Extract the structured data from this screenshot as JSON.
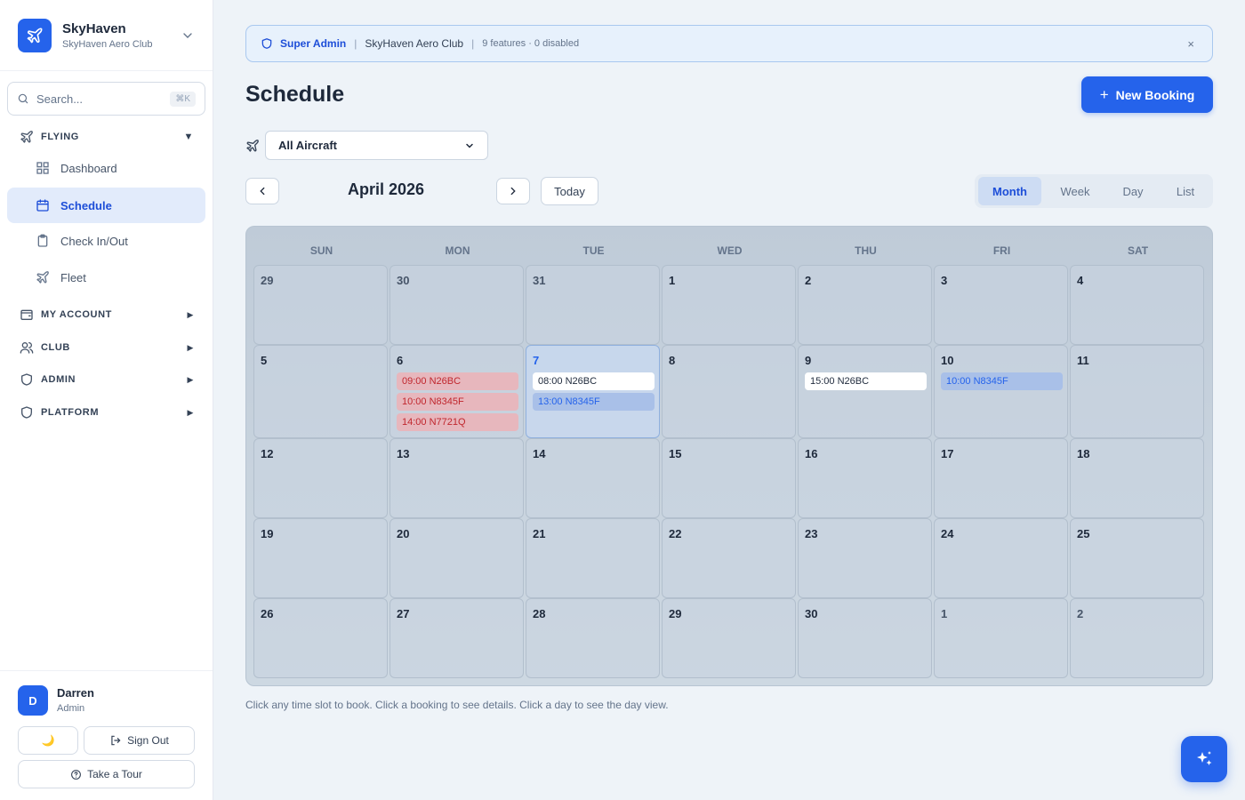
{
  "brand": {
    "name": "SkyHaven",
    "subtitle": "SkyHaven Aero Club"
  },
  "search": {
    "placeholder": "Search...",
    "shortcut": "⌘K"
  },
  "sidebar": {
    "sections": [
      {
        "label": "FLYING",
        "expanded": true
      },
      {
        "label": "MY ACCOUNT",
        "expanded": false
      },
      {
        "label": "CLUB",
        "expanded": false
      },
      {
        "label": "ADMIN",
        "expanded": false
      },
      {
        "label": "PLATFORM",
        "expanded": false
      }
    ],
    "items": [
      {
        "label": "Dashboard",
        "active": false
      },
      {
        "label": "Schedule",
        "active": true
      },
      {
        "label": "Check In/Out",
        "active": false
      },
      {
        "label": "Fleet",
        "active": false
      }
    ]
  },
  "user": {
    "initial": "D",
    "name": "Darren",
    "role": "Admin"
  },
  "footer": {
    "theme_icon": "🌙",
    "sign_out": "Sign Out",
    "tour": "Take a Tour"
  },
  "banner": {
    "role": "Super Admin",
    "club": "SkyHaven Aero Club",
    "features": "9 features · 0 disabled",
    "close": "×"
  },
  "page": {
    "title": "Schedule",
    "new_booking": "New Booking"
  },
  "filter": {
    "aircraft": "All Aircraft"
  },
  "calendar": {
    "month_label": "April 2026",
    "today_label": "Today",
    "views": [
      "Month",
      "Week",
      "Day",
      "List"
    ],
    "active_view": "Month",
    "weekdays": [
      "SUN",
      "MON",
      "TUE",
      "WED",
      "THU",
      "FRI",
      "SAT"
    ],
    "weeks": [
      [
        {
          "day": "29",
          "muted": true
        },
        {
          "day": "30",
          "muted": true
        },
        {
          "day": "31",
          "muted": true
        },
        {
          "day": "1"
        },
        {
          "day": "2"
        },
        {
          "day": "3"
        },
        {
          "day": "4"
        }
      ],
      [
        {
          "day": "5"
        },
        {
          "day": "6",
          "events": [
            {
              "text": "09:00 N26BC",
              "style": "red"
            },
            {
              "text": "10:00 N8345F",
              "style": "red"
            },
            {
              "text": "14:00 N7721Q",
              "style": "red"
            }
          ]
        },
        {
          "day": "7",
          "today": true,
          "events": [
            {
              "text": "08:00 N26BC",
              "style": "white"
            },
            {
              "text": "13:00 N8345F",
              "style": "blue"
            }
          ]
        },
        {
          "day": "8"
        },
        {
          "day": "9",
          "events": [
            {
              "text": "15:00 N26BC",
              "style": "white"
            }
          ]
        },
        {
          "day": "10",
          "events": [
            {
              "text": "10:00 N8345F",
              "style": "blue"
            }
          ]
        },
        {
          "day": "11"
        }
      ],
      [
        {
          "day": "12"
        },
        {
          "day": "13"
        },
        {
          "day": "14"
        },
        {
          "day": "15"
        },
        {
          "day": "16"
        },
        {
          "day": "17"
        },
        {
          "day": "18"
        }
      ],
      [
        {
          "day": "19"
        },
        {
          "day": "20"
        },
        {
          "day": "21"
        },
        {
          "day": "22"
        },
        {
          "day": "23"
        },
        {
          "day": "24"
        },
        {
          "day": "25"
        }
      ],
      [
        {
          "day": "26"
        },
        {
          "day": "27"
        },
        {
          "day": "28"
        },
        {
          "day": "29"
        },
        {
          "day": "30"
        },
        {
          "day": "1",
          "muted": true
        },
        {
          "day": "2",
          "muted": true
        }
      ]
    ]
  },
  "hint": "Click any time slot to book. Click a booking to see details. Click a day to see the day view.",
  "colors": {
    "accent": "#2563eb",
    "booking_conflict": "#c0262d"
  }
}
